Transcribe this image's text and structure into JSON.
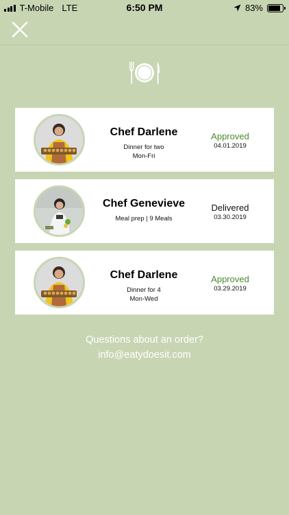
{
  "status_bar": {
    "carrier": "T-Mobile",
    "network": "LTE",
    "time": "6:50 PM",
    "battery": "83%",
    "battery_level": 0.83
  },
  "header": {
    "close_icon": "close-icon",
    "logo_icon": "fork-plate-knife-icon"
  },
  "orders": [
    {
      "chef_name": "Chef Darlene",
      "detail_line1": "Dinner for two",
      "detail_line2": "Mon-Fri",
      "status": "Approved",
      "date": "04.01.2019",
      "status_color": "#4a8a2a"
    },
    {
      "chef_name": "Chef Genevieve",
      "detail_line1": "Meal prep | 9 Meals",
      "detail_line2": "",
      "status": "Delivered",
      "date": "03.30.2019",
      "status_color": "#111111"
    },
    {
      "chef_name": "Chef Darlene",
      "detail_line1": "Dinner for 4",
      "detail_line2": "Mon-Wed",
      "status": "Approved",
      "date": "03.29.2019",
      "status_color": "#4a8a2a"
    }
  ],
  "footer": {
    "question": "Questions about an order?",
    "email": "info@eatydoesit.com"
  },
  "colors": {
    "background": "#c8d5b3",
    "approved": "#4a8a2a"
  }
}
